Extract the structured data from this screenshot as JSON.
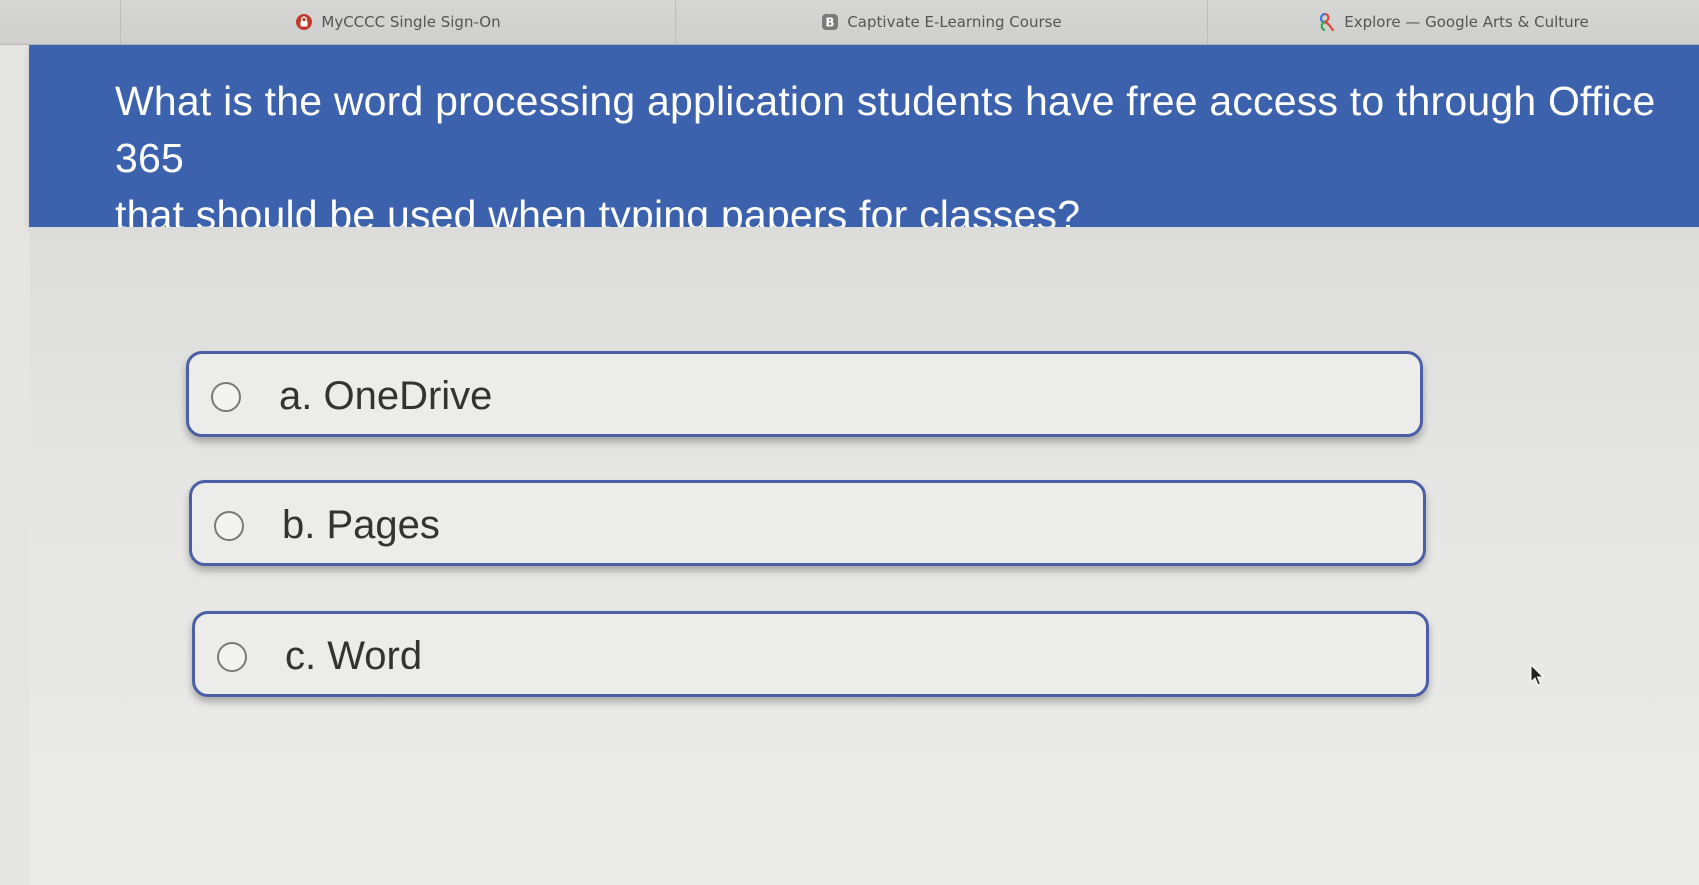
{
  "browser": {
    "tabs": [
      {
        "label": "MyCCCC Single Sign-On",
        "icon": "lock-icon",
        "color": "#c0392b"
      },
      {
        "label": "Captivate E-Learning Course",
        "icon": "b-badge-icon",
        "color": "#777777"
      },
      {
        "label": "Explore — Google Arts & Culture",
        "icon": "arts-culture-icon",
        "color": "#e0443a"
      }
    ]
  },
  "question": {
    "text": "What is the word processing application students have free access to through Office 365\nthat should be used when typing papers for classes?"
  },
  "answers": [
    {
      "label": "a. OneDrive",
      "selected": false
    },
    {
      "label": "b. Pages",
      "selected": false
    },
    {
      "label": "c. Word",
      "selected": false
    }
  ],
  "colors": {
    "question_background": "#3c61ad",
    "option_border": "#4b5ea6"
  }
}
